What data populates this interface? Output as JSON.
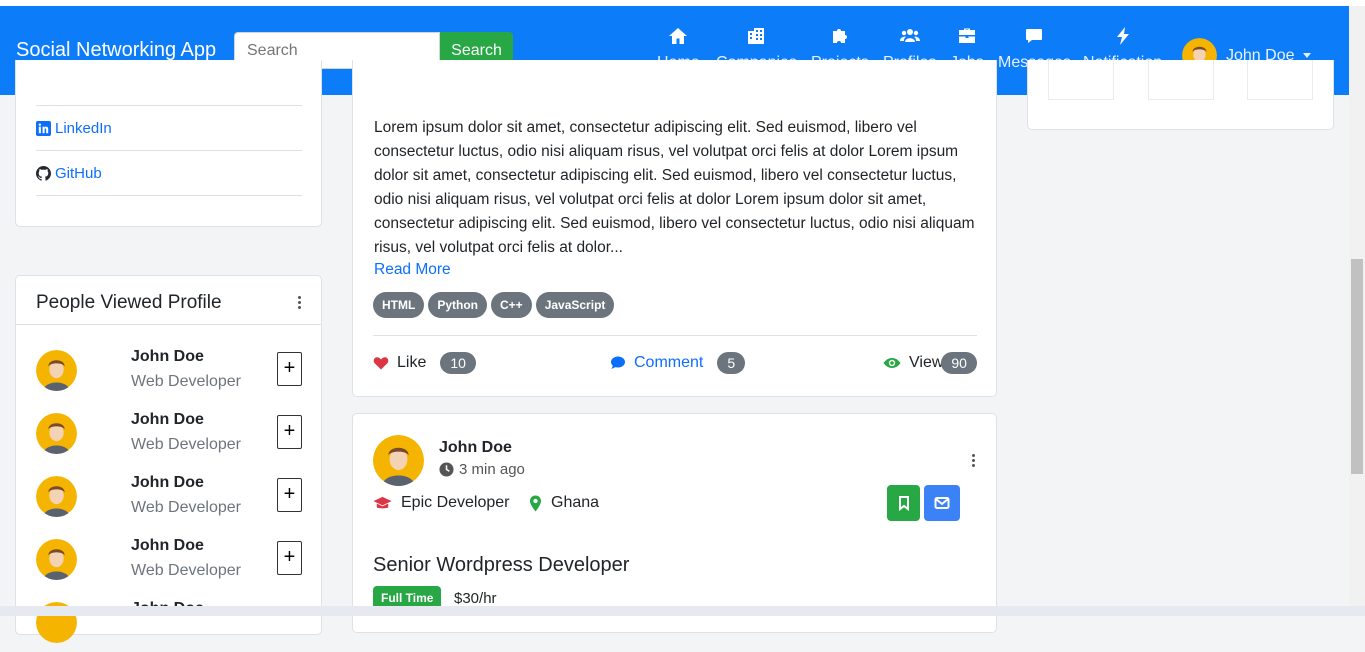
{
  "navbar": {
    "brand": "Social Networking App",
    "search_placeholder": "Search",
    "search_button": "Search",
    "items": [
      {
        "label": "Home",
        "icon": "home-icon"
      },
      {
        "label": "Companies",
        "icon": "building-icon"
      },
      {
        "label": "Projects",
        "icon": "puzzle-icon"
      },
      {
        "label": "Profiles",
        "icon": "users-icon"
      },
      {
        "label": "Jobs",
        "icon": "briefcase-icon"
      },
      {
        "label": "Messages",
        "icon": "chat-icon"
      },
      {
        "label": "Notification",
        "icon": "bolt-icon"
      }
    ],
    "user_name": "John Doe"
  },
  "social_links": [
    {
      "label": "LinkedIn",
      "icon": "linkedin-icon"
    },
    {
      "label": "GitHub",
      "icon": "github-icon"
    }
  ],
  "people_viewed": {
    "title": "People Viewed Profile",
    "people": [
      {
        "name": "John Doe",
        "role": "Web Developer",
        "add": "+"
      },
      {
        "name": "John Doe",
        "role": "Web Developer",
        "add": "+"
      },
      {
        "name": "John Doe",
        "role": "Web Developer",
        "add": "+"
      },
      {
        "name": "John Doe",
        "role": "Web Developer",
        "add": "+"
      },
      {
        "name": "John Doe",
        "role": "",
        "add": ""
      }
    ]
  },
  "post": {
    "body": "Lorem ipsum dolor sit amet, consectetur adipiscing elit. Sed euismod, libero vel consectetur luctus, odio nisi aliquam risus, vel volutpat orci felis at dolor Lorem ipsum dolor sit amet, consectetur adipiscing elit. Sed euismod, libero vel consectetur luctus, odio nisi aliquam risus, vel volutpat orci felis at dolor Lorem ipsum dolor sit amet, consectetur adipiscing elit. Sed euismod, libero vel consectetur luctus, odio nisi aliquam risus, vel volutpat orci felis at dolor...",
    "read_more": "Read More",
    "tags": [
      "HTML",
      "Python",
      "C++",
      "JavaScript"
    ],
    "like_label": "Like",
    "like_count": "10",
    "comment_label": "Comment",
    "comment_count": "5",
    "view_label": "View",
    "view_count": "90",
    "colors": {
      "like": "#dc3545",
      "comment": "#0d6efd",
      "view": "#28a745"
    }
  },
  "job": {
    "author": "John Doe",
    "time": "3 min ago",
    "company": "Epic Developer",
    "location": "Ghana",
    "title": "Senior Wordpress Developer",
    "type": "Full Time",
    "rate": "$30/hr",
    "colors": {
      "bookmark": "#28a745",
      "mail": "#3b82f6"
    }
  },
  "theme": {
    "navbar": "#0d7cf9",
    "accent": "#0d6efd"
  }
}
